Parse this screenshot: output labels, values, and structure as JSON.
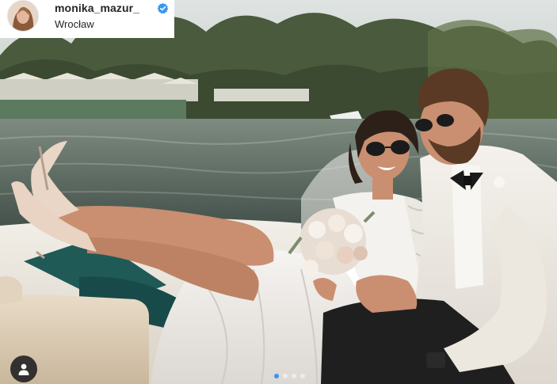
{
  "header": {
    "username": "monika_mazur_",
    "location": "Wrocław",
    "verified_icon": "verified-badge-icon",
    "verified_color": "#3897f0"
  },
  "post": {
    "image_alt": "Wedding couple in a boat",
    "tag_icon": "user-tag-icon",
    "carousel": {
      "count": 4,
      "active_index": 1,
      "active_color": "#3897f0"
    }
  }
}
